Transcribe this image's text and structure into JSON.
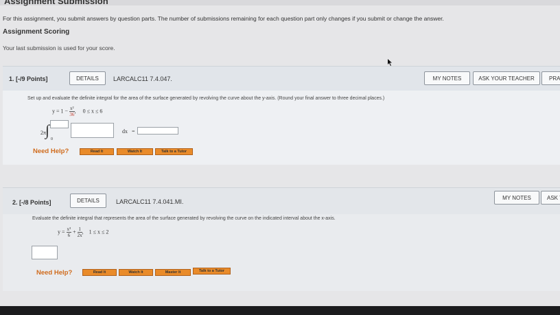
{
  "header": {
    "cut_title": "Assignment Submission",
    "intro": "For this assignment, you submit answers by question parts. The number of submissions remaining for each question part only changes if you submit or change the answer.",
    "scoring_title": "Assignment Scoring",
    "last_submission": "Your last submission is used for your score."
  },
  "q1": {
    "number": "1.",
    "points": "[-/9 Points]",
    "details": "DETAILS",
    "ref": "LARCALC11 7.4.047.",
    "my_notes": "MY NOTES",
    "ask_teacher": "ASK YOUR TEACHER",
    "practice": "PRACTICE ANOTHER",
    "prompt": "Set up and evaluate the definite integral for the area of the surface generated by revolving the curve about the y-axis. (Round your final answer to three decimal places.)",
    "eq_lhs": "y = 1 −",
    "eq_num": "x²",
    "eq_den": "36",
    "eq_comma": ",",
    "interval": "0 ≤ x ≤ 6",
    "two_pi": "2π",
    "integral_sign": "∫",
    "lower_limit": "0",
    "dx": "dx",
    "equals": "=",
    "need_help": "Need Help?",
    "help_buttons": [
      "Read It",
      "Watch It",
      "Talk to a Tutor"
    ]
  },
  "q2": {
    "number": "2.",
    "points": "[-/8 Points]",
    "details": "DETAILS",
    "ref": "LARCALC11 7.4.041.MI.",
    "my_notes": "MY NOTES",
    "ask_teacher": "ASK YOUR TEACHER",
    "prompt": "Evaluate the definite integral that represents the area of the surface generated by revolving the curve on the indicated interval about the x-axis.",
    "eq_lhs": "y =",
    "f1_num": "x³",
    "f1_den": "6",
    "plus": "+",
    "f2_num": "1",
    "f2_den": "2x",
    "eq_comma": ",",
    "interval": "1 ≤ x ≤ 2",
    "need_help": "Need Help?",
    "help_buttons": [
      "Read It",
      "Watch It",
      "Master It",
      "Talk to a Tutor"
    ]
  },
  "colors": {
    "accent_orange": "#e98b2a",
    "need_help_text": "#d06b1c",
    "question_bg": "#eef0f3"
  }
}
